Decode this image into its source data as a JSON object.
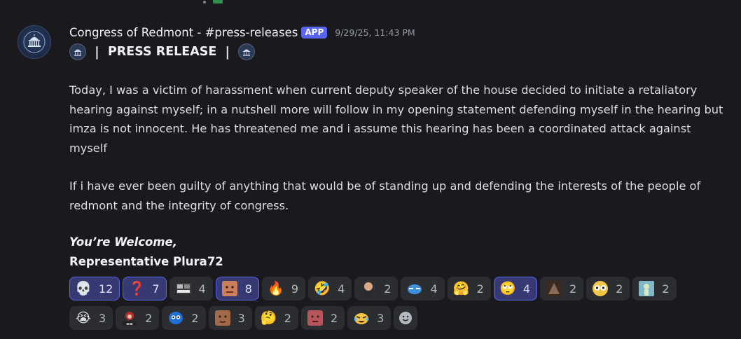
{
  "message": {
    "author": "Congress of Redmont - #press-releases",
    "badge": "APP",
    "timestamp": "9/29/25, 11:43 PM",
    "title_bar": "|",
    "title": "PRESS RELEASE",
    "paragraphs": [
      "Today, I was a victim of harassment when current deputy speaker of the house decided to initiate a retaliatory hearing against myself; in a nutshell more will follow in my opening statement defending myself in the hearing but imza is not innocent. He has threatened me and i assume this hearing has been a coordinated attack against myself",
      "If i have ever been guilty of anything that would be of standing up and defending the interests of the people of redmont and the integrity of congress."
    ],
    "signoff": "You’re Welcome,",
    "signature": "Representative Plura72"
  },
  "reactions": [
    {
      "emoji": "💀",
      "icon": "skull-emoji",
      "count": "12",
      "me": true
    },
    {
      "emoji": "❓",
      "icon": "question-emoji",
      "count": "7",
      "me": true
    },
    {
      "emoji": "",
      "icon": "custom-cinema-emoji",
      "count": "4",
      "me": false
    },
    {
      "emoji": "",
      "icon": "custom-face-emoji",
      "count": "8",
      "me": true
    },
    {
      "emoji": "🔥",
      "icon": "fire-emoji",
      "count": "9",
      "me": false
    },
    {
      "emoji": "🤣",
      "icon": "rofl-emoji",
      "count": "4",
      "me": false
    },
    {
      "emoji": "",
      "icon": "custom-person-emoji",
      "count": "2",
      "me": false
    },
    {
      "emoji": "",
      "icon": "custom-crying-blue-emoji",
      "count": "4",
      "me": false
    },
    {
      "emoji": "🤗",
      "icon": "hugging-emoji",
      "count": "2",
      "me": false
    },
    {
      "emoji": "🙄",
      "icon": "eye-roll-emoji",
      "count": "4",
      "me": true
    },
    {
      "emoji": "",
      "icon": "custom-dark-emoji",
      "count": "2",
      "me": false
    },
    {
      "emoji": "",
      "icon": "custom-wide-eyes-emoji",
      "count": "2",
      "me": false
    },
    {
      "emoji": "",
      "icon": "custom-statue-emoji",
      "count": "2",
      "me": false
    },
    {
      "emoji": "😭",
      "icon": "loudly-crying-emoji",
      "count": "3",
      "me": false
    },
    {
      "emoji": "",
      "icon": "custom-gulag-emoji",
      "count": "2",
      "me": false
    },
    {
      "emoji": "",
      "icon": "custom-blue-blob-emoji",
      "count": "2",
      "me": false
    },
    {
      "emoji": "",
      "icon": "custom-face-2-emoji",
      "count": "3",
      "me": false
    },
    {
      "emoji": "🤔",
      "icon": "thinking-emoji",
      "count": "2",
      "me": false
    },
    {
      "emoji": "",
      "icon": "custom-face-3-emoji",
      "count": "2",
      "me": false
    },
    {
      "emoji": "",
      "icon": "custom-crying-laugh-emoji",
      "count": "3",
      "me": false
    }
  ],
  "rows": [
    13,
    7
  ],
  "colors": {
    "background": "#1a1a1e",
    "reaction_bg": "#2b2d31",
    "reaction_me_bg": "#373a72",
    "accent": "#5865f2"
  }
}
